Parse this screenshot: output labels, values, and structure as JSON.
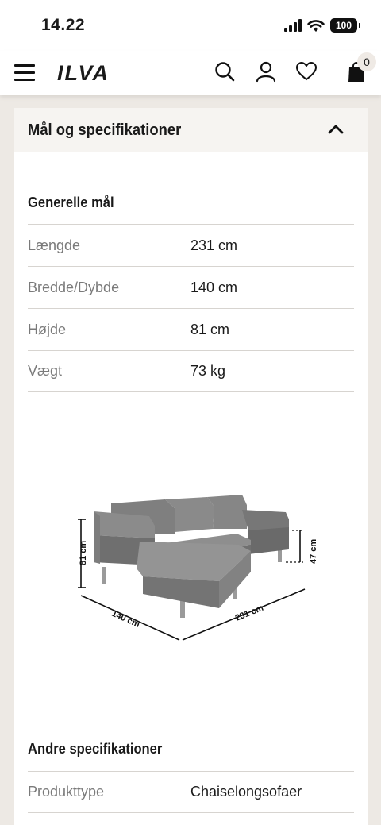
{
  "status_bar": {
    "time": "14.22",
    "battery": "100"
  },
  "header": {
    "logo": "ILVA",
    "cart_count": "0"
  },
  "accordion": {
    "title": "Mål og specifikationer"
  },
  "general": {
    "title": "Generelle mål",
    "rows": [
      {
        "label": "Længde",
        "value": "231 cm"
      },
      {
        "label": "Bredde/Dybde",
        "value": "140 cm"
      },
      {
        "label": "Højde",
        "value": "81 cm"
      },
      {
        "label": "Vægt",
        "value": "73 kg"
      }
    ]
  },
  "diagram": {
    "height_label": "81 cm",
    "seat_height_label": "47 cm",
    "depth_label": "140 cm",
    "length_label": "231 cm"
  },
  "other": {
    "title": "Andre specifikationer",
    "rows": [
      {
        "label": "Produkttype",
        "value": "Chaiselongsofaer"
      }
    ]
  }
}
